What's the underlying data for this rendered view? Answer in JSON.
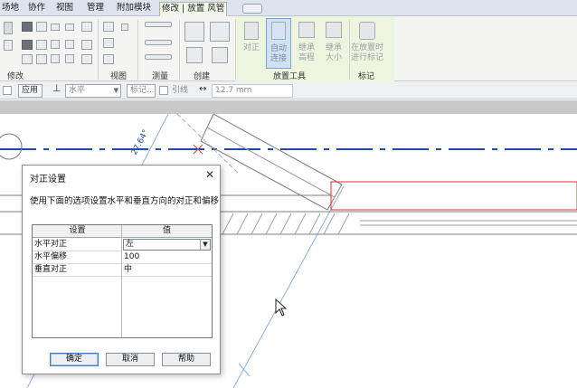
{
  "tabs": [
    "场地",
    "协作",
    "视图",
    "管理",
    "附加模块",
    "修改 | 放置 风管"
  ],
  "ribbon": {
    "groups": {
      "modify": "修改",
      "view": "视图",
      "measure": "测量",
      "create": "创建",
      "placement_tools": "放置工具",
      "tag": "标记"
    },
    "buttons": {
      "justify": "对正",
      "auto_connect_1": "自动",
      "auto_connect_2": "连接",
      "inherit_elev_1": "继承",
      "inherit_elev_2": "高程",
      "inherit_size_1": "继承",
      "inherit_size_2": "大小",
      "tag_on_place_1": "在放置时",
      "tag_on_place_2": "进行标记"
    }
  },
  "optbar": {
    "apply": "应用",
    "horizontal_value": "水平",
    "label_field": "标记...",
    "leader": "引线",
    "offset": "12.7 mm"
  },
  "canvas": {
    "angle_label": "27.64°"
  },
  "dialog": {
    "title": "对正设置",
    "instruction": "使用下面的选项设置水平和垂直方向的对正和偏移",
    "columns": [
      "设置",
      "值"
    ],
    "rows": [
      {
        "setting": "水平对正",
        "value": "左"
      },
      {
        "setting": "水平偏移",
        "value": "100"
      },
      {
        "setting": "垂直对正",
        "value": "中"
      }
    ],
    "buttons": {
      "ok": "确定",
      "cancel": "取消",
      "help": "帮助"
    }
  },
  "colors": {
    "accent_blue": "#1f4aa6",
    "ref_blue": "#7fa9e6",
    "red_highlight": "#e03030"
  }
}
